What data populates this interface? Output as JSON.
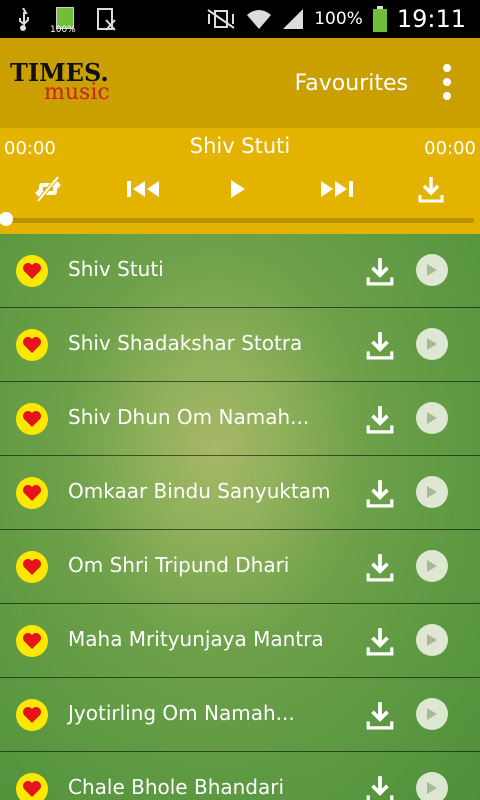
{
  "status_bar": {
    "battery_percent": "100%",
    "time": "19:11",
    "small_battery_label": "100%"
  },
  "app_bar": {
    "logo_line1": "TIMES.",
    "logo_line2": "music",
    "favourites_label": "Favourites",
    "menu_icon": "overflow-menu-icon"
  },
  "player": {
    "elapsed": "00:00",
    "duration": "00:00",
    "title": "Shiv Stuti",
    "progress": 0
  },
  "tracks": [
    {
      "title": "Shiv Stuti"
    },
    {
      "title": "Shiv Shadakshar Stotra"
    },
    {
      "title": "Shiv Dhun Om Namah..."
    },
    {
      "title": "Omkaar Bindu Sanyuktam"
    },
    {
      "title": "Om Shri Tripund Dhari"
    },
    {
      "title": "Maha Mrityunjaya Mantra"
    },
    {
      "title": "Jyotirling Om Namah..."
    },
    {
      "title": "Chale Bhole Bhandari"
    }
  ],
  "colors": {
    "app_bar": "#c9a000",
    "player": "#e3b300",
    "heart_bg": "#ffe800",
    "heart": "#e5141c",
    "logo_music": "#d21f1f"
  }
}
